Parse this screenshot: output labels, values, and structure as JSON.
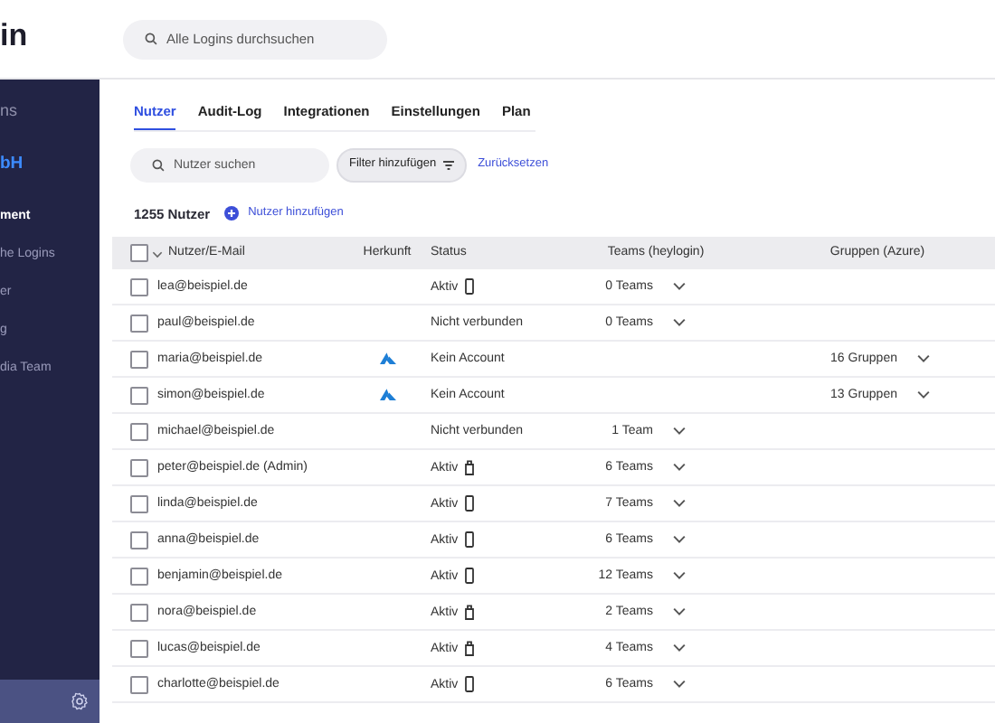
{
  "logo": "in",
  "global_search": {
    "placeholder": "Alle Logins durchsuchen"
  },
  "sidebar": {
    "items": [
      {
        "label": "ns",
        "kind": "section",
        "selected": false
      },
      {
        "label": "bH",
        "kind": "org",
        "selected": false
      },
      {
        "label": "ment",
        "kind": "item",
        "selected": true
      },
      {
        "label": "he Logins",
        "kind": "item",
        "selected": false
      },
      {
        "label": "er",
        "kind": "item",
        "selected": false
      },
      {
        "label": "g",
        "kind": "item",
        "selected": false
      },
      {
        "label": "dia Team",
        "kind": "item",
        "selected": false
      }
    ]
  },
  "tabs": [
    {
      "label": "Nutzer",
      "selected": true
    },
    {
      "label": "Audit-Log",
      "selected": false
    },
    {
      "label": "Integrationen",
      "selected": false
    },
    {
      "label": "Einstellungen",
      "selected": false
    },
    {
      "label": "Plan",
      "selected": false
    }
  ],
  "user_search": {
    "placeholder": "Nutzer suchen"
  },
  "filter_button": "Filter hinzufügen",
  "reset_link": "Zurücksetzen",
  "user_count": "1255 Nutzer",
  "add_user": "Nutzer hinzufügen",
  "table": {
    "select_all": {
      "checked": false
    },
    "columns": [
      "Nutzer/E-Mail",
      "Herkunft",
      "Status",
      "Teams (heylogin)",
      "Gruppen (Azure)"
    ],
    "rows": [
      {
        "email": "lea@beispiel.de",
        "checked": false,
        "azure": false,
        "status": "Aktiv",
        "device": {
          "kind": "phone"
        },
        "teams": "0 Teams"
      },
      {
        "email": "paul@beispiel.de",
        "checked": false,
        "azure": false,
        "status": "Nicht verbunden",
        "teams": "0 Teams"
      },
      {
        "email": "maria@beispiel.de",
        "checked": false,
        "azure": true,
        "status": "Kein Account",
        "groups": "16 Gruppen"
      },
      {
        "email": "simon@beispiel.de",
        "checked": false,
        "azure": true,
        "status": "Kein Account",
        "groups": "13 Gruppen"
      },
      {
        "email": "michael@beispiel.de",
        "checked": false,
        "azure": false,
        "status": "Nicht verbunden",
        "teams": "1 Team"
      },
      {
        "email": "peter@beispiel.de (Admin)",
        "checked": false,
        "azure": false,
        "status": "Aktiv",
        "device": {
          "kind": "key"
        },
        "teams": "6 Teams"
      },
      {
        "email": "linda@beispiel.de",
        "checked": false,
        "azure": false,
        "status": "Aktiv",
        "device": {
          "kind": "phone"
        },
        "teams": "7 Teams"
      },
      {
        "email": "anna@beispiel.de",
        "checked": false,
        "azure": false,
        "status": "Aktiv",
        "device": {
          "kind": "phone"
        },
        "teams": "6 Teams"
      },
      {
        "email": "benjamin@beispiel.de",
        "checked": false,
        "azure": false,
        "status": "Aktiv",
        "device": {
          "kind": "phone"
        },
        "teams": "12 Teams"
      },
      {
        "email": "nora@beispiel.de",
        "checked": false,
        "azure": false,
        "status": "Aktiv",
        "device": {
          "kind": "key"
        },
        "teams": "2 Teams"
      },
      {
        "email": "lucas@beispiel.de",
        "checked": false,
        "azure": false,
        "status": "Aktiv",
        "device": {
          "kind": "key"
        },
        "teams": "4 Teams"
      },
      {
        "email": "charlotte@beispiel.de",
        "checked": false,
        "azure": false,
        "status": "Aktiv",
        "device": {
          "kind": "phone"
        },
        "teams": "6 Teams"
      }
    ]
  }
}
